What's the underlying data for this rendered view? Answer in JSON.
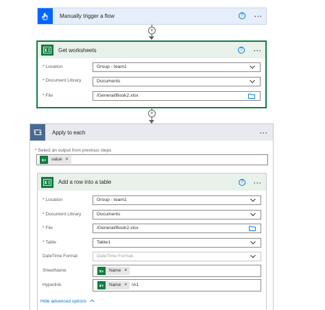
{
  "trigger": {
    "title": "Manually trigger a flow",
    "help": "?",
    "more": "···"
  },
  "get_worksheets": {
    "title": "Get worksheets",
    "help": "?",
    "more": "···",
    "fields": [
      {
        "label": "Location",
        "value": "Group - team1"
      },
      {
        "label": "Document Library",
        "value": "Documents"
      },
      {
        "label": "File",
        "value": "/General/Book2.xlsx"
      }
    ]
  },
  "apply_to_each": {
    "title": "Apply to each",
    "more": "···",
    "select_label": "Select an output from previous steps",
    "token": "value"
  },
  "add_row": {
    "title": "Add a row into a table",
    "help": "?",
    "more": "···",
    "fields": [
      {
        "label": "Location",
        "value": "Group - team1",
        "required": true
      },
      {
        "label": "Document Library",
        "value": "Documents",
        "required": true
      },
      {
        "label": "File",
        "value": "/General/Book2.xlsx",
        "required": true
      },
      {
        "label": "Table",
        "value": "Table1",
        "required": true
      },
      {
        "label": "DateTime Format",
        "placeholder": "DateTime Format.",
        "required": false
      },
      {
        "label": "SheetName",
        "token": "Name",
        "required": false
      },
      {
        "label": "Hyperlink",
        "token": "Name",
        "suffix": "!A1",
        "required": false
      }
    ],
    "advanced_link": "Hide advanced options"
  },
  "colors": {
    "trigger_header": "#e5eefa",
    "excel_header": "#e8f1ea",
    "excel_green": "#107c41",
    "loop_header": "#e8eaef",
    "loop_icon": "#486991",
    "trigger_icon": "#0066ff",
    "link": "#0078d4"
  }
}
